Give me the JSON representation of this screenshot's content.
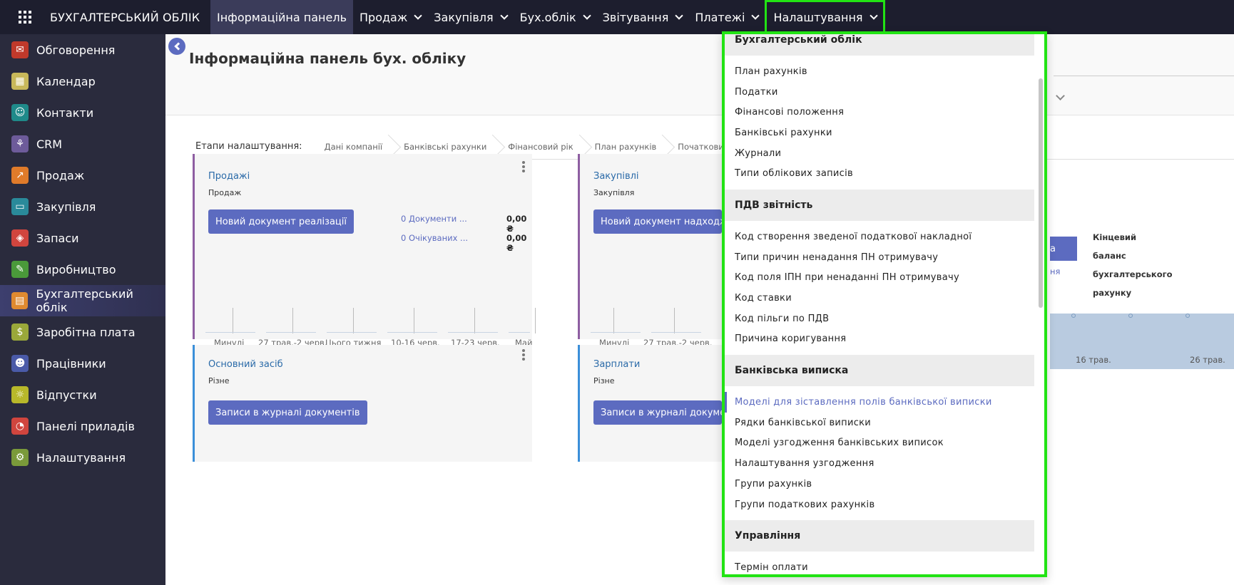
{
  "topbar": {
    "app_menu_icon": "grid-icon",
    "brand": "БУХГАЛТЕРСЬКИЙ ОБЛІК",
    "menu": [
      {
        "label": "Інформаційна панель",
        "has_dropdown": false
      },
      {
        "label": "Продаж",
        "has_dropdown": true
      },
      {
        "label": "Закупівля",
        "has_dropdown": true
      },
      {
        "label": "Бух.облік",
        "has_dropdown": true
      },
      {
        "label": "Звітування",
        "has_dropdown": true
      },
      {
        "label": "Платежі",
        "has_dropdown": true
      },
      {
        "label": "Налаштування",
        "has_dropdown": true
      }
    ]
  },
  "sidebar": {
    "items": [
      {
        "label": "Обговорення",
        "icon": "chat-icon",
        "color": "#c0392b"
      },
      {
        "label": "Календар",
        "icon": "calendar-icon",
        "color": "#c8b85a"
      },
      {
        "label": "Контакти",
        "icon": "contacts-icon",
        "color": "#1f8a8a"
      },
      {
        "label": "CRM",
        "icon": "handshake-icon",
        "color": "#6d5b9a"
      },
      {
        "label": "Продаж",
        "icon": "chart-line-icon",
        "color": "#e07b2a"
      },
      {
        "label": "Закупівля",
        "icon": "credit-card-icon",
        "color": "#2a8a9a"
      },
      {
        "label": "Запаси",
        "icon": "box-icon",
        "color": "#d0453e"
      },
      {
        "label": "Виробництво",
        "icon": "wrench-icon",
        "color": "#4a9a3a"
      },
      {
        "label": "Бухгалтерський облік",
        "icon": "ledger-icon",
        "color": "#e08a30"
      },
      {
        "label": "Заробітна плата",
        "icon": "dollar-icon",
        "color": "#9aa83a"
      },
      {
        "label": "Працівники",
        "icon": "people-icon",
        "color": "#4a5aa8"
      },
      {
        "label": "Відпустки",
        "icon": "sun-icon",
        "color": "#b8b82a"
      },
      {
        "label": "Панелі приладів",
        "icon": "dashboard-icon",
        "color": "#d0453e"
      },
      {
        "label": "Налаштування",
        "icon": "gear-icon",
        "color": "#7a9a3a"
      }
    ],
    "active_index": 8
  },
  "main": {
    "title": "Інформаційна панель бух. обліку",
    "steps_label": "Етапи налаштування:",
    "steps": [
      "Дані компанії",
      "Банківські рахунки",
      "Фінансовий рік",
      "План рахунків",
      "Початковий"
    ],
    "cards": [
      {
        "title": "Продажі",
        "subtitle": "Продаж",
        "button": "Новий документ реалізації",
        "bar_color": "#8e5ea2",
        "stats": [
          {
            "label": "0 Документи ...",
            "value": "0,00 ₴"
          },
          {
            "label": "0 Очікуваних ...",
            "value": "0,00 ₴"
          }
        ],
        "graph_labels": [
          "Минулі",
          "27 трав.-2 черв.",
          "Цього тижня",
          "10-16 черв.",
          "17-23 черв.",
          "Майбутні"
        ]
      },
      {
        "title": "Закупівлі",
        "subtitle": "Закупівля",
        "button": "Новий документ надходження",
        "bar_color": "#8e5ea2",
        "graph_labels": [
          "Минулі",
          "27 трав.-2 черв."
        ]
      },
      {
        "title": "Основний засіб",
        "subtitle": "Різне",
        "button": "Записи в журналі документів",
        "bar_color": "#3b8fd9"
      },
      {
        "title": "Зарплати",
        "subtitle": "Різне",
        "button": "Записи в журналі документів",
        "bar_color": "#3b8fd9"
      }
    ],
    "right_panel": {
      "button_fragment": "а",
      "link_fragment": "ня",
      "lines": [
        "Кінцевий",
        "баланс",
        "бухгалтерського",
        "рахунку"
      ],
      "chart_labels": [
        "16 трав.",
        "26 трав."
      ]
    }
  },
  "dropdown": {
    "sections": [
      {
        "header": "Бухгалтерський облік",
        "items": [
          "План рахунків",
          "Податки",
          "Фінансові положення",
          "Банківські рахунки",
          "Журнали",
          "Типи облікових записів"
        ]
      },
      {
        "header": "ПДВ звітність",
        "items": [
          "Код створення зведеної податкової накладної",
          "Типи причин ненадання ПН отримувачу",
          "Код поля ІПН при ненаданні ПН отримувачу",
          "Код ставки",
          "Код пільги по ПДВ",
          "Причина коригування"
        ]
      },
      {
        "header": "Банківська виписка",
        "items": [
          "Моделі для зіставлення полів банківської виписки",
          "Рядки банківської виписки",
          "Моделі узгодження банківських виписок",
          "Налаштування узгодження",
          "Групи рахунків",
          "Групи податкових рахунків"
        ]
      },
      {
        "header": "Управління",
        "items": [
          "Термін оплати"
        ]
      }
    ],
    "active_item": "Моделі для зіставлення полів банківської виписки"
  },
  "accent_color": "#5c6bc0",
  "highlight_color": "#22e314"
}
